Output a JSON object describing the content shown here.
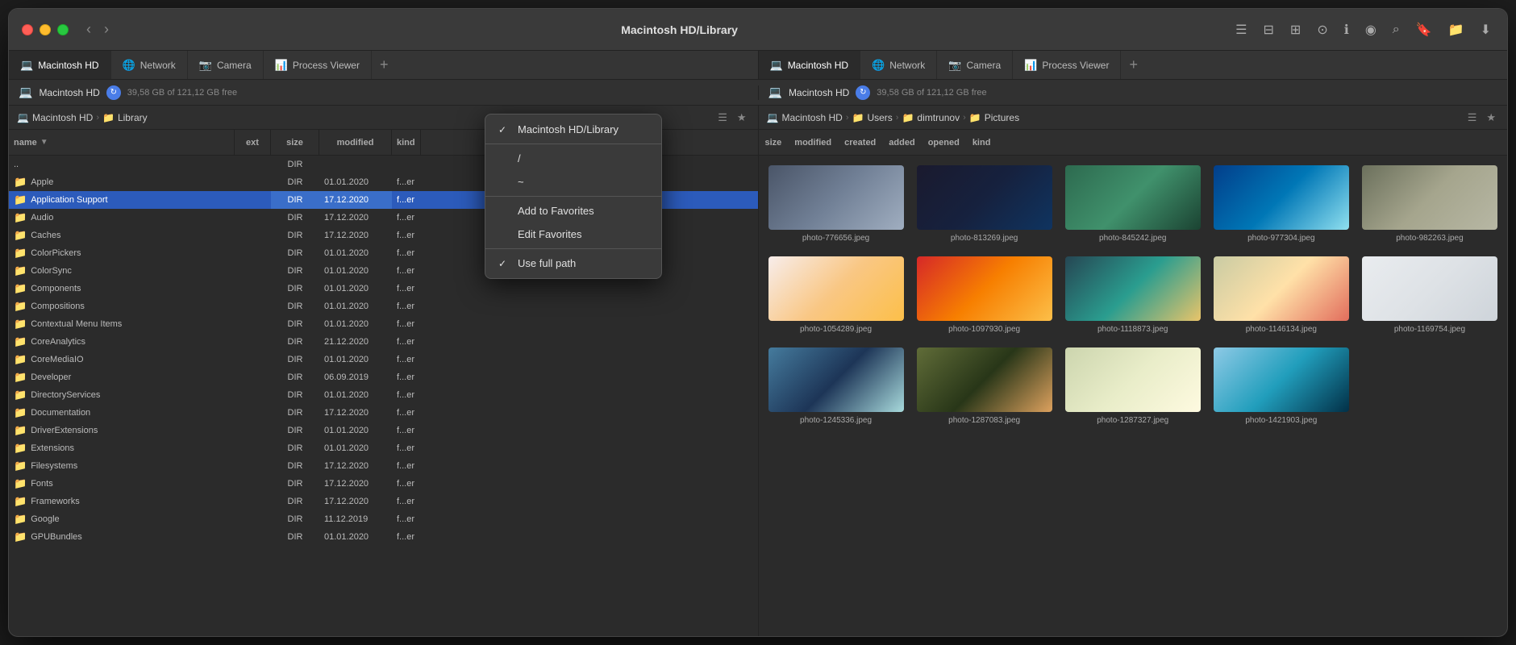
{
  "window": {
    "title": "Macintosh HD/Library"
  },
  "tabs_left": [
    {
      "id": "macintosh-hd-tab",
      "label": "Macintosh HD",
      "icon": "💻",
      "active": true
    },
    {
      "id": "network-tab-left",
      "label": "Network",
      "icon": "🌐",
      "active": false
    },
    {
      "id": "camera-tab-left",
      "label": "Camera",
      "icon": "📷",
      "active": false
    },
    {
      "id": "process-viewer-tab-left",
      "label": "Process Viewer",
      "icon": "📊",
      "active": false
    }
  ],
  "tabs_right": [
    {
      "id": "macintosh-hd-tab-right",
      "label": "Macintosh HD",
      "icon": "💻",
      "active": true
    },
    {
      "id": "network-tab-right",
      "label": "Network",
      "icon": "🌐",
      "active": false
    },
    {
      "id": "camera-tab-right",
      "label": "Camera",
      "icon": "📷",
      "active": false
    },
    {
      "id": "process-viewer-tab-right",
      "label": "Process Viewer",
      "icon": "📊",
      "active": false
    }
  ],
  "disk_left": {
    "name": "Macintosh HD",
    "info": "39,58 GB of 121,12 GB free"
  },
  "disk_right": {
    "name": "Macintosh HD",
    "info": "39,58 GB of 121,12 GB free"
  },
  "breadcrumb_left": [
    {
      "label": "Macintosh HD",
      "icon": "💻"
    },
    {
      "label": "Library",
      "icon": "📁"
    }
  ],
  "breadcrumb_right": [
    {
      "label": "Macintosh HD",
      "icon": "💻"
    },
    {
      "label": "Users",
      "icon": "📁"
    },
    {
      "label": "dimtrunov",
      "icon": "📁"
    },
    {
      "label": "Pictures",
      "icon": "📁"
    }
  ],
  "col_headers": {
    "name": "name",
    "ext": "ext",
    "size": "size",
    "modified": "modified",
    "kind": "kind"
  },
  "files": [
    {
      "name": "..",
      "ext": "",
      "size": "DIR",
      "modified": "",
      "kind": ""
    },
    {
      "name": "Apple",
      "ext": "",
      "size": "DIR",
      "modified": "01.01.2020",
      "kind": "f...er"
    },
    {
      "name": "Application Support",
      "ext": "",
      "size": "DIR",
      "modified": "17.12.2020",
      "kind": "f...er",
      "selected": true
    },
    {
      "name": "Audio",
      "ext": "",
      "size": "DIR",
      "modified": "17.12.2020",
      "kind": "f...er"
    },
    {
      "name": "Caches",
      "ext": "",
      "size": "DIR",
      "modified": "17.12.2020",
      "kind": "f...er"
    },
    {
      "name": "ColorPickers",
      "ext": "",
      "size": "DIR",
      "modified": "01.01.2020",
      "kind": "f...er"
    },
    {
      "name": "ColorSync",
      "ext": "",
      "size": "DIR",
      "modified": "01.01.2020",
      "kind": "f...er"
    },
    {
      "name": "Components",
      "ext": "",
      "size": "DIR",
      "modified": "01.01.2020",
      "kind": "f...er"
    },
    {
      "name": "Compositions",
      "ext": "",
      "size": "DIR",
      "modified": "01.01.2020",
      "kind": "f...er"
    },
    {
      "name": "Contextual Menu Items",
      "ext": "",
      "size": "DIR",
      "modified": "01.01.2020",
      "kind": "f...er"
    },
    {
      "name": "CoreAnalytics",
      "ext": "",
      "size": "DIR",
      "modified": "21.12.2020",
      "kind": "f...er"
    },
    {
      "name": "CoreMediaIO",
      "ext": "",
      "size": "DIR",
      "modified": "01.01.2020",
      "kind": "f...er"
    },
    {
      "name": "Developer",
      "ext": "",
      "size": "DIR",
      "modified": "06.09.2019",
      "kind": "f...er"
    },
    {
      "name": "DirectoryServices",
      "ext": "",
      "size": "DIR",
      "modified": "01.01.2020",
      "kind": "f...er"
    },
    {
      "name": "Documentation",
      "ext": "",
      "size": "DIR",
      "modified": "17.12.2020",
      "kind": "f...er"
    },
    {
      "name": "DriverExtensions",
      "ext": "",
      "size": "DIR",
      "modified": "01.01.2020",
      "kind": "f...er"
    },
    {
      "name": "Extensions",
      "ext": "",
      "size": "DIR",
      "modified": "01.01.2020",
      "kind": "f...er"
    },
    {
      "name": "Filesystems",
      "ext": "",
      "size": "DIR",
      "modified": "17.12.2020",
      "kind": "f...er"
    },
    {
      "name": "Fonts",
      "ext": "",
      "size": "DIR",
      "modified": "17.12.2020",
      "kind": "f...er"
    },
    {
      "name": "Frameworks",
      "ext": "",
      "size": "DIR",
      "modified": "17.12.2020",
      "kind": "f...er"
    },
    {
      "name": "Google",
      "ext": "",
      "size": "DIR",
      "modified": "11.12.2019",
      "kind": "f...er"
    },
    {
      "name": "GPUBundles",
      "ext": "",
      "size": "DIR",
      "modified": "01.01.2020",
      "kind": "f...er"
    }
  ],
  "photos": [
    {
      "id": "p1",
      "label": "photo-776656.jpeg",
      "colorClass": "photo-1"
    },
    {
      "id": "p2",
      "label": "photo-813269.jpeg",
      "colorClass": "photo-2"
    },
    {
      "id": "p3",
      "label": "photo-845242.jpeg",
      "colorClass": "photo-3"
    },
    {
      "id": "p4",
      "label": "photo-977304.jpeg",
      "colorClass": "photo-4"
    },
    {
      "id": "p5",
      "label": "photo-982263.jpeg",
      "colorClass": "photo-5"
    },
    {
      "id": "p6",
      "label": "photo-1054289.jpeg",
      "colorClass": "photo-6"
    },
    {
      "id": "p7",
      "label": "photo-1097930.jpeg",
      "colorClass": "photo-7"
    },
    {
      "id": "p8",
      "label": "photo-1118873.jpeg",
      "colorClass": "photo-8"
    },
    {
      "id": "p9",
      "label": "photo-1146134.jpeg",
      "colorClass": "photo-9"
    },
    {
      "id": "p10",
      "label": "photo-1169754.jpeg",
      "colorClass": "photo-10"
    },
    {
      "id": "p11",
      "label": "photo-1245336.jpeg",
      "colorClass": "photo-11"
    },
    {
      "id": "p12",
      "label": "photo-1287083.jpeg",
      "colorClass": "photo-12"
    },
    {
      "id": "p13",
      "label": "photo-1287327.jpeg",
      "colorClass": "photo-13"
    },
    {
      "id": "p14",
      "label": "photo-1421903.jpeg",
      "colorClass": "photo-14"
    }
  ],
  "right_col_headers": [
    "size",
    "modified",
    "created",
    "added",
    "opened",
    "kind"
  ],
  "context_menu": {
    "items": [
      {
        "id": "macintosh-hd-library",
        "label": "Macintosh HD/Library",
        "checked": true,
        "separator_after": false
      },
      {
        "id": "separator1",
        "separator": true
      },
      {
        "id": "root",
        "label": "/",
        "checked": false,
        "separator_after": false
      },
      {
        "id": "home",
        "label": "~",
        "checked": false,
        "separator_after": false
      },
      {
        "id": "separator2",
        "separator": true
      },
      {
        "id": "add-to-favorites",
        "label": "Add to Favorites",
        "checked": false,
        "separator_after": false
      },
      {
        "id": "edit-favorites",
        "label": "Edit Favorites",
        "checked": false,
        "separator_after": false
      },
      {
        "id": "separator3",
        "separator": true
      },
      {
        "id": "use-full-path",
        "label": "Use full path",
        "checked": true,
        "separator_after": false
      }
    ]
  },
  "toolbar": {
    "list_icon": "≡",
    "grid_icon": "⊞",
    "columns_icon": "⊟",
    "toggle_icon": "⊙",
    "info_icon": "ℹ",
    "preview_icon": "👁",
    "binoculars_icon": "🔭",
    "bookmark_icon": "🔖",
    "folder_icon": "📁",
    "download_icon": "⬇"
  }
}
